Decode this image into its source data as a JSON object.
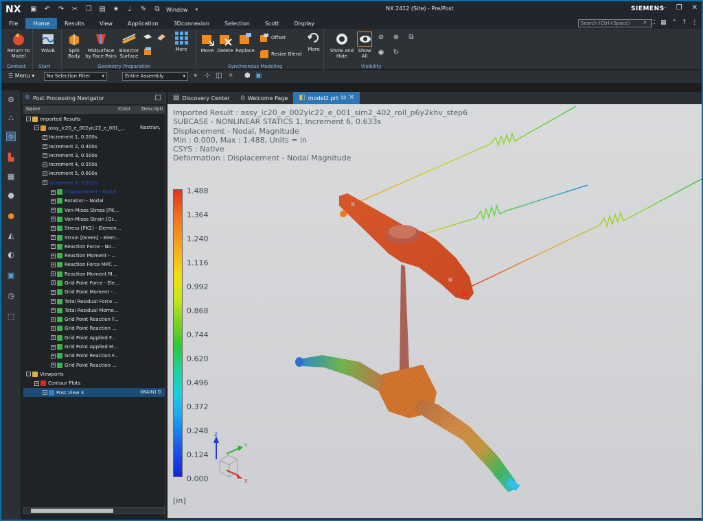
{
  "app": {
    "logo": "NX",
    "window_menu": "Window",
    "title": "NX 2412 (Site) - Pre/Post",
    "brand": "SIEMENS"
  },
  "menu_tabs": [
    "File",
    "Home",
    "Results",
    "View",
    "Application",
    "3Dconnexion",
    "Selection",
    "Scott",
    "Display"
  ],
  "active_tab": "Home",
  "search": {
    "placeholder": "Search (Ctrl+Space)"
  },
  "ribbon": {
    "return_to_model": "Return to Model",
    "wave": "WAVE",
    "split_body": "Split Body",
    "midsurface": "Midsurface by Face Pairs",
    "bisector": "Bisector Surface",
    "more1": "More",
    "move": "Move",
    "delete": "Delete",
    "replace": "Replace",
    "offset": "Offset",
    "resize_blend": "Resize Blend",
    "more2": "More",
    "show_hide": "Show and Hide",
    "show_all": "Show All",
    "groups": {
      "context": "Context",
      "start": "Start",
      "geometry": "Geometry Preparation",
      "sync": "Synchronous Modeling",
      "visibility": "Visibility"
    }
  },
  "toolbar": {
    "menu": "Menu",
    "filter": "No Selection Filter",
    "assembly": "Entire Assembly"
  },
  "navigator": {
    "title": "Post Processing Navigator",
    "col_name": "Name",
    "col_color": "Color",
    "col_desc": "Descripti",
    "rows": [
      {
        "label": "Imported Results",
        "indent": 0,
        "icon": "folder"
      },
      {
        "label": "assy_ic20_e_002yic22_e_001_...",
        "indent": 1,
        "icon": "result",
        "desc": "Nastran,"
      },
      {
        "label": "Increment 1, 0.200s",
        "indent": 2,
        "icon": "none"
      },
      {
        "label": "Increment 2, 0.400s",
        "indent": 2,
        "icon": "none"
      },
      {
        "label": "Increment 3, 0.500s",
        "indent": 2,
        "icon": "none"
      },
      {
        "label": "Increment 4, 0.550s",
        "indent": 2,
        "icon": "none"
      },
      {
        "label": "Increment 5, 0.600s",
        "indent": 2,
        "icon": "none"
      },
      {
        "label": "Increment 6, 0.633s",
        "indent": 2,
        "icon": "none",
        "hl": true
      },
      {
        "label": "Displacement - Nodal",
        "indent": 3,
        "icon": "leaf",
        "hl": true
      },
      {
        "label": "Rotation - Nodal",
        "indent": 3,
        "icon": "leaf"
      },
      {
        "label": "Von-Mises Stress [PK...",
        "indent": 3,
        "icon": "leaf"
      },
      {
        "label": "Von-Mises Strain [Gr...",
        "indent": 3,
        "icon": "leaf"
      },
      {
        "label": "Stress [PK2] - Elemen...",
        "indent": 3,
        "icon": "leaf"
      },
      {
        "label": "Strain [Green] - Elem...",
        "indent": 3,
        "icon": "leaf"
      },
      {
        "label": "Reaction Force - No...",
        "indent": 3,
        "icon": "leaf"
      },
      {
        "label": "Reaction Moment - ...",
        "indent": 3,
        "icon": "leaf"
      },
      {
        "label": "Reaction Force MPC ...",
        "indent": 3,
        "icon": "leaf"
      },
      {
        "label": "Reaction Moment M...",
        "indent": 3,
        "icon": "leaf"
      },
      {
        "label": "Grid Point Force - Ele...",
        "indent": 3,
        "icon": "leaf"
      },
      {
        "label": "Grid Point Moment -...",
        "indent": 3,
        "icon": "leaf"
      },
      {
        "label": "Total Residual Force ...",
        "indent": 3,
        "icon": "leaf"
      },
      {
        "label": "Total Residual Mome...",
        "indent": 3,
        "icon": "leaf"
      },
      {
        "label": "Grid Point Reaction F...",
        "indent": 3,
        "icon": "leaf"
      },
      {
        "label": "Grid Point Reaction ...",
        "indent": 3,
        "icon": "leaf"
      },
      {
        "label": "Grid Point Applied F...",
        "indent": 3,
        "icon": "leaf"
      },
      {
        "label": "Grid Point Applied M...",
        "indent": 3,
        "icon": "leaf"
      },
      {
        "label": "Grid Point Reaction F...",
        "indent": 3,
        "icon": "leaf"
      },
      {
        "label": "Grid Point Reaction ...",
        "indent": 3,
        "icon": "leaf"
      },
      {
        "label": "Viewports",
        "indent": 0,
        "icon": "folder"
      },
      {
        "label": "Contour Plots",
        "indent": 1,
        "icon": "red"
      },
      {
        "label": "Post View 3",
        "indent": 2,
        "icon": "view",
        "desc": "(MAIN) D",
        "sel": true
      }
    ]
  },
  "doc_tabs": [
    {
      "label": "Discovery Center",
      "active": false
    },
    {
      "label": "Welcome Page",
      "active": false
    },
    {
      "label": "model2.prt",
      "active": true
    }
  ],
  "result_info": [
    "Imported Result : assy_ic20_e_002yic22_e_001_sim2_402_roll_p6y2khv_step6",
    "SUBCASE - NONLINEAR STATICS 1, Increment 6, 0.633s",
    "Displacement - Nodal, Magnitude",
    "Min : 0.000, Max : 1.488, Units = in",
    "CSYS : Native",
    "Deformation : Displacement - Nodal Magnitude"
  ],
  "legend": {
    "ticks": [
      "1.488",
      "1.364",
      "1.240",
      "1.116",
      "0.992",
      "0.868",
      "0.744",
      "0.620",
      "0.496",
      "0.372",
      "0.248",
      "0.124",
      "0.000"
    ],
    "units": "[in]"
  },
  "triad": {
    "x": "X",
    "y": "Y",
    "z": "Z"
  }
}
